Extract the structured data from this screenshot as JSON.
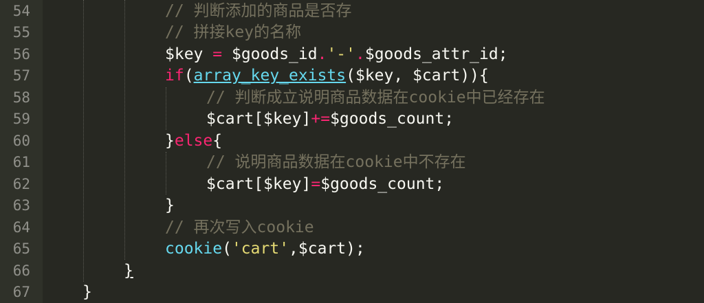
{
  "editor": {
    "theme_colors": {
      "background": "#272822",
      "comment": "#75715E",
      "keyword": "#F92672",
      "function": "#66D9EF",
      "string": "#E6DB74",
      "text": "#F8F8F2",
      "line_number": "#90908A"
    },
    "lines": [
      {
        "num": "54",
        "tokens": [
          {
            "t": "// 判断添加的商品是否存",
            "c": "cm"
          }
        ]
      },
      {
        "num": "55",
        "tokens": [
          {
            "t": "// 拼接key的名称",
            "c": "cm"
          }
        ]
      },
      {
        "num": "56",
        "tokens": [
          {
            "t": "$key",
            "c": "var"
          },
          {
            "t": " ",
            "c": "pun"
          },
          {
            "t": "=",
            "c": "op"
          },
          {
            "t": " ",
            "c": "pun"
          },
          {
            "t": "$goods_id",
            "c": "var"
          },
          {
            "t": ".",
            "c": "op"
          },
          {
            "t": "'-'",
            "c": "str"
          },
          {
            "t": ".",
            "c": "op"
          },
          {
            "t": "$goods_attr_id",
            "c": "var"
          },
          {
            "t": ";",
            "c": "pun"
          }
        ]
      },
      {
        "num": "57",
        "tokens": [
          {
            "t": "if",
            "c": "kw"
          },
          {
            "t": "(",
            "c": "pun"
          },
          {
            "t": "array_key_exists",
            "c": "fn-u"
          },
          {
            "t": "(",
            "c": "pun"
          },
          {
            "t": "$key",
            "c": "var"
          },
          {
            "t": ", ",
            "c": "pun"
          },
          {
            "t": "$cart",
            "c": "var"
          },
          {
            "t": ")){",
            "c": "pun"
          }
        ]
      },
      {
        "num": "58",
        "tokens": [
          {
            "t": "// 判断成立说明商品数据在cookie中已经存在",
            "c": "cm"
          }
        ]
      },
      {
        "num": "59",
        "tokens": [
          {
            "t": "$cart",
            "c": "var"
          },
          {
            "t": "[",
            "c": "pun"
          },
          {
            "t": "$key",
            "c": "var"
          },
          {
            "t": "]",
            "c": "pun"
          },
          {
            "t": "+=",
            "c": "op"
          },
          {
            "t": "$goods_count",
            "c": "var"
          },
          {
            "t": ";",
            "c": "pun"
          }
        ]
      },
      {
        "num": "60",
        "tokens": [
          {
            "t": "}",
            "c": "pun"
          },
          {
            "t": "else",
            "c": "kw"
          },
          {
            "t": "{",
            "c": "pun"
          }
        ]
      },
      {
        "num": "61",
        "tokens": [
          {
            "t": "// 说明商品数据在cookie中不存在",
            "c": "cm"
          }
        ]
      },
      {
        "num": "62",
        "tokens": [
          {
            "t": "$cart",
            "c": "var"
          },
          {
            "t": "[",
            "c": "pun"
          },
          {
            "t": "$key",
            "c": "var"
          },
          {
            "t": "]",
            "c": "pun"
          },
          {
            "t": "=",
            "c": "op"
          },
          {
            "t": "$goods_count",
            "c": "var"
          },
          {
            "t": ";",
            "c": "pun"
          }
        ]
      },
      {
        "num": "63",
        "tokens": [
          {
            "t": "}",
            "c": "pun"
          }
        ]
      },
      {
        "num": "64",
        "tokens": [
          {
            "t": "// 再次写入cookie",
            "c": "cm"
          }
        ]
      },
      {
        "num": "65",
        "tokens": [
          {
            "t": "cookie",
            "c": "fn"
          },
          {
            "t": "(",
            "c": "pun"
          },
          {
            "t": "'cart'",
            "c": "str"
          },
          {
            "t": ",",
            "c": "pun"
          },
          {
            "t": "$cart",
            "c": "var"
          },
          {
            "t": ");",
            "c": "pun"
          }
        ]
      },
      {
        "num": "66",
        "tokens": [
          {
            "t": "}",
            "c": "brace-u"
          }
        ]
      },
      {
        "num": "67",
        "tokens": [
          {
            "t": "}",
            "c": "pun"
          }
        ]
      }
    ]
  }
}
